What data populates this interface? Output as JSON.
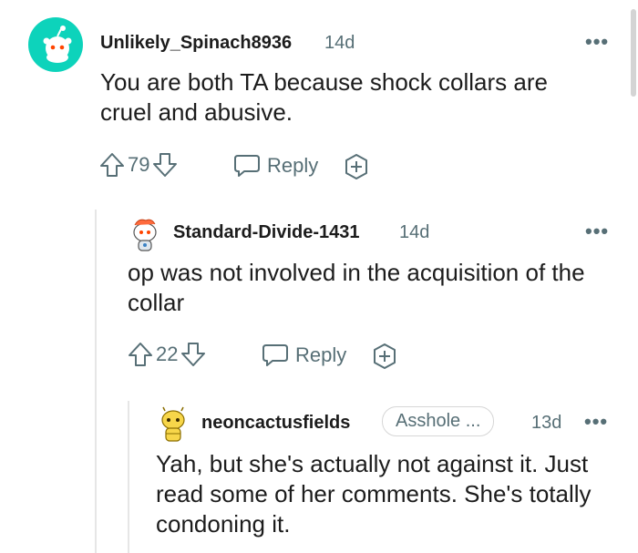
{
  "comments": [
    {
      "username": "Unlikely_Spinach8936",
      "age": "14d",
      "text": "You are both TA because shock collars are cruel and abusive.",
      "votes": "79",
      "reply_label": "Reply",
      "more": "•••"
    },
    {
      "username": "Standard-Divide-1431",
      "age": "14d",
      "text": "op was not involved in the acquisition of the collar",
      "votes": "22",
      "reply_label": "Reply",
      "more": "•••"
    },
    {
      "username": "neoncactusfields",
      "flair": "Asshole ...",
      "age": "13d",
      "text": "Yah, but she's actually not against it. Just read some of her comments. She's totally condoning it.",
      "more": "•••"
    }
  ],
  "colors": {
    "text": "#1c1c1c",
    "meta": "#576f76",
    "avatar_teal": "#0dd3bb",
    "thread_line": "#e6e6e6"
  }
}
